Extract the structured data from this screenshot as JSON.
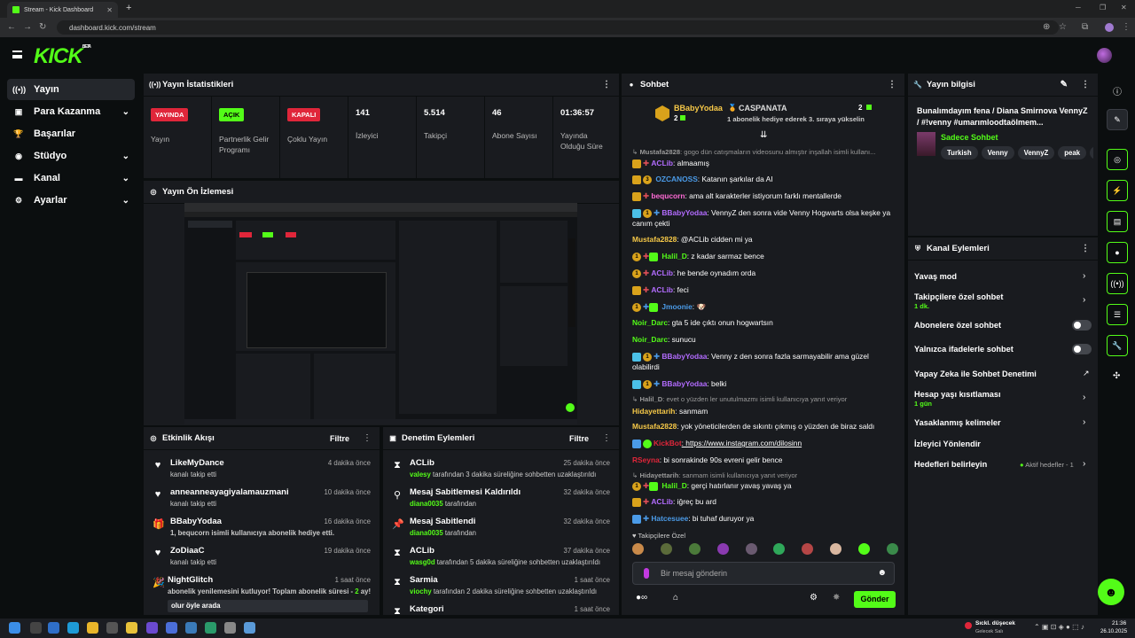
{
  "browser": {
    "tab_title": "Stream - Kick Dashboard",
    "new_tab": "+",
    "url": "dashboard.kick.com/stream"
  },
  "logo": {
    "text": "KICK",
    "beta": "BETA"
  },
  "sidebar": {
    "items": [
      {
        "label": "Yayın",
        "icon": "broadcast-icon",
        "active": true,
        "expandable": false
      },
      {
        "label": "Para Kazanma",
        "icon": "wallet-icon",
        "active": false,
        "expandable": true
      },
      {
        "label": "Başarılar",
        "icon": "trophy-icon",
        "active": false,
        "expandable": false
      },
      {
        "label": "Stüdyo",
        "icon": "studio-icon",
        "active": false,
        "expandable": true
      },
      {
        "label": "Kanal",
        "icon": "channel-icon",
        "active": false,
        "expandable": true
      },
      {
        "label": "Ayarlar",
        "icon": "gear-icon",
        "active": false,
        "expandable": true
      }
    ]
  },
  "stats": {
    "title": "Yayın İstatistikleri",
    "items": [
      {
        "badge": "YAYINDA",
        "badge_color": "#e0263a",
        "label": "Yayın"
      },
      {
        "badge": "AÇIK",
        "badge_color": "#53fc18",
        "label": "Partnerlik Gelir Programı"
      },
      {
        "badge": "KAPALI",
        "badge_color": "#e0263a",
        "label": "Çoklu Yayın"
      },
      {
        "value": "141",
        "label": "İzleyici"
      },
      {
        "value": "5.514",
        "label": "Takipçi"
      },
      {
        "value": "46",
        "label": "Abone Sayısı"
      },
      {
        "value": "01:36:57",
        "label": "Yayında Olduğu Süre"
      }
    ]
  },
  "preview": {
    "title": "Yayın Ön İzlemesi"
  },
  "activity": {
    "title": "Etkinlik Akışı",
    "filter": "Filtre",
    "items": [
      {
        "user": "LikeMyDance",
        "text": "kanalı takip etti",
        "time": "4 dakika önce",
        "icon": "heart-icon"
      },
      {
        "user": "anneanneayagiyalamauzmani",
        "text": "kanalı takip etti",
        "time": "10 dakika önce",
        "icon": "heart-icon"
      },
      {
        "user": "BBabyYodaa",
        "text": "1, bequcorn isimli kullanıcıya abonelik hediye etti.",
        "time": "16 dakika önce",
        "icon": "gift-icon"
      },
      {
        "user": "ZoDiaaC",
        "text": "kanalı takip etti",
        "time": "19 dakika önce",
        "icon": "heart-icon"
      },
      {
        "user": "NightGlitch",
        "text_a": "abonelik yenilemesini kutluyor! Toplam abonelik süresi - ",
        "text_b": "2",
        "text_c": " ay!",
        "time": "1 saat önce",
        "icon": "party-icon",
        "quote": "olur öyle arada"
      }
    ]
  },
  "moderation": {
    "title": "Denetim Eylemleri",
    "filter": "Filtre",
    "items": [
      {
        "action": "ACLib",
        "actor": "valesy",
        "text": " tarafından 3 dakika süreliğine sohbetten uzaklaştırıldı",
        "time": "25 dakika önce",
        "icon": "hourglass-icon"
      },
      {
        "action": "Mesaj Sabitlemesi Kaldırıldı",
        "actor": "diana0035",
        "text": " tarafından",
        "time": "32 dakika önce",
        "icon": "unpin-icon"
      },
      {
        "action": "Mesaj Sabitlendi",
        "actor": "diana0035",
        "text": " tarafından",
        "time": "32 dakika önce",
        "icon": "pin-icon"
      },
      {
        "action": "ACLib",
        "actor": "wasg0d",
        "text": " tarafından 5 dakika süreliğine sohbetten uzaklaştırıldı",
        "time": "37 dakika önce",
        "icon": "hourglass-icon"
      },
      {
        "action": "Sarmia",
        "actor": "viochy",
        "text": " tarafından 2 dakika süreliğine sohbetten uzaklaştırıldı",
        "time": "1 saat önce",
        "icon": "hourglass-icon"
      },
      {
        "action": "Kategori",
        "actor": "",
        "text": "",
        "time": "1 saat önce",
        "icon": "hourglass-icon"
      }
    ]
  },
  "chat": {
    "title": "Sohbet",
    "pinned_user": "BBabyYodaa",
    "pinned_count": "2",
    "gift_user": "CASPANATA",
    "gift_count": "2",
    "gift_text": "1 abonelik hediye ederek 3. sıraya yükselin",
    "messages": [
      {
        "user": "Mustafa2828",
        "color": "#999999",
        "text": ": gogo dün catışmaların videosunu almıştır inşallah isimli kullanı...",
        "reply": true
      },
      {
        "user": "ACLib",
        "color": "#b36cff",
        "text": ": almaamış"
      },
      {
        "user": "OZCANOSS",
        "color": "#4b9be8",
        "text": ": Katanın şarkılar da AI"
      },
      {
        "user": "bequcorn",
        "color": "#ff6ad5",
        "text": ": ama alt karakterler istiyorum farklı mentallerde"
      },
      {
        "user": "BBabyYodaa",
        "color": "#b36cff",
        "text": ": VennyZ den sonra vide Venny Hogwarts olsa keşke ya canım çekti"
      },
      {
        "user": "Mustafa2828",
        "color": "#f7c948",
        "text": ": @ACLib cidden mi ya"
      },
      {
        "user": "Halil_D",
        "color": "#53fc18",
        "text": ": z kadar sarmaz bence"
      },
      {
        "user": "ACLib",
        "color": "#b36cff",
        "text": ": he bende oynadım orda"
      },
      {
        "user": "ACLib",
        "color": "#b36cff",
        "text": ": feci"
      },
      {
        "user": "Jmoonie",
        "color": "#4b9be8",
        "text": ": 🐶"
      },
      {
        "user": "Noir_Darc",
        "color": "#53fc18",
        "text": ": gta 5 ide çıktı onun hogwartsın"
      },
      {
        "user": "Noir_Darc",
        "color": "#53fc18",
        "text": ": sunucu"
      },
      {
        "user": "BBabyYodaa",
        "color": "#b36cff",
        "text": ": Venny z den sonra fazla sarmayabilir ama güzel olabilirdi"
      },
      {
        "user": "BBabyYodaa",
        "color": "#b36cff",
        "text": ": belki"
      },
      {
        "user": "Halil_D",
        "color": "#999999",
        "text": ": evet o yüzden ler unutulmazmı isimli kullanıcıya yanıt veriyor",
        "reply": true
      },
      {
        "user": "Hidayettarih",
        "color": "#f7c948",
        "text": ": sanmam"
      },
      {
        "user": "Mustafa2828",
        "color": "#f7c948",
        "text": ": yok yöneticilerden de sıkıntı çıkmış o yüzden de biraz saldı"
      },
      {
        "user": "KickBot",
        "color": "#e0263a",
        "text": ": https://www.instagram.com/dilosinn"
      },
      {
        "user": "RSeyna",
        "color": "#e0263a",
        "text": ": bi sonrakinde 90s evreni gelir bence"
      },
      {
        "user": "Hidayettarih",
        "color": "#999999",
        "text": ": sanmam isimli kullanıcıya yanıt veriyor",
        "reply": true
      },
      {
        "user": "Halil_D",
        "color": "#53fc18",
        "text": ": gerçi hatırlanır yavaş yavaş ya"
      },
      {
        "user": "ACLib",
        "color": "#b36cff",
        "text": ": iğreç bu ard"
      },
      {
        "user": "Hatcesuee",
        "color": "#4b9be8",
        "text": ": bi tuhaf duruyor ya"
      }
    ],
    "emote_label": "Takipçilere Özel",
    "input_placeholder": "Bir mesaj gönderin",
    "send": "Gönder"
  },
  "stream_info": {
    "title": "Yayın bilgisi",
    "stream_title": "Bunalımdayım fena / Diana Smirnova VennyZ / #!venny #umarımloodtaölmem...",
    "mode": "Sadece Sohbet",
    "tags": [
      "Turkish",
      "Venny",
      "VennyZ",
      "peak",
      "va"
    ]
  },
  "channel_actions": {
    "title": "Kanal Eylemleri",
    "items": [
      {
        "label": "Yavaş mod",
        "sub": "",
        "control": "arrow"
      },
      {
        "label": "Takipçilere özel sohbet",
        "sub": "1 dk.",
        "control": "arrow"
      },
      {
        "label": "Abonelere özel sohbet",
        "sub": "",
        "control": "toggle"
      },
      {
        "label": "Yalnızca ifadelerle sohbet",
        "sub": "",
        "control": "toggle"
      },
      {
        "label": "Yapay Zeka ile Sohbet Denetimi",
        "sub": "",
        "control": "external"
      },
      {
        "label": "Hesap yaşı kısıtlaması",
        "sub": "1 gün",
        "control": "arrow"
      },
      {
        "label": "Yasaklanmış kelimeler",
        "sub": "",
        "control": "arrow"
      },
      {
        "label": "İzleyici Yönlendir",
        "sub": "",
        "control": "none"
      },
      {
        "label": "Hedefleri belirleyin",
        "sub": "",
        "control": "arrow",
        "status": "Aktif hedefler - 1"
      }
    ]
  },
  "taskbar": {
    "weather": "Sıckl. düşecek",
    "weather_sub": "Gelecek Salı",
    "time": "21:36",
    "date": "26.10.2025"
  }
}
